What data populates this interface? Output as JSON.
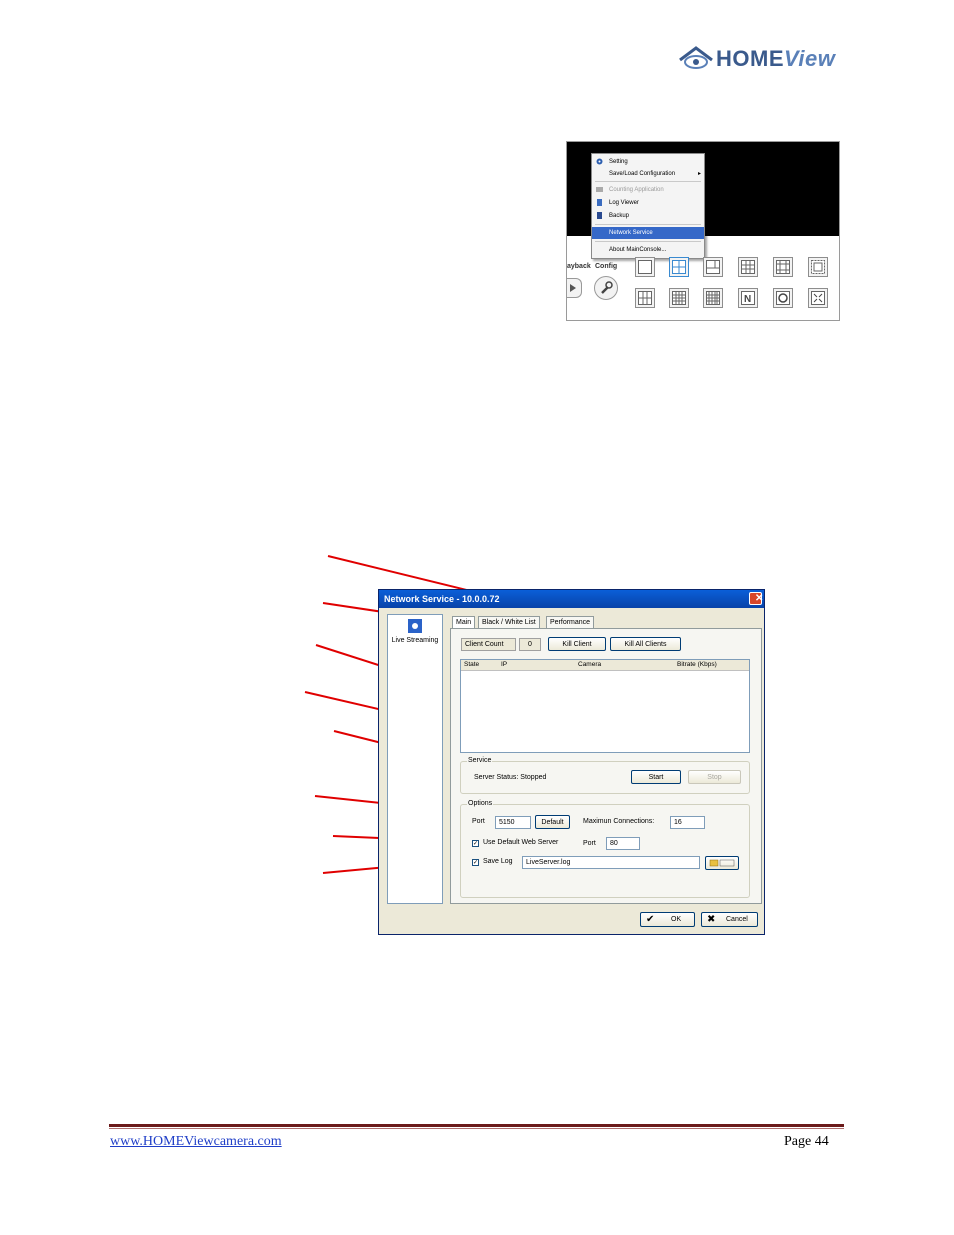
{
  "logo": {
    "brand_bold": "HOME",
    "brand_italic": "View"
  },
  "menu": {
    "items": [
      {
        "label": "Setting",
        "state": "normal"
      },
      {
        "label": "Save/Load Configuration",
        "state": "normal"
      },
      {
        "label": "Counting Application",
        "state": "disabled"
      },
      {
        "label": "Log Viewer",
        "state": "normal"
      },
      {
        "label": "Backup",
        "state": "normal"
      },
      {
        "label": "Network Service",
        "state": "highlighted"
      },
      {
        "label": "About MainConsole...",
        "state": "normal"
      }
    ],
    "playback_label": "ayback",
    "config_label": "Config"
  },
  "dialog": {
    "title": "Network Service - 10.0.0.72",
    "sidebar_item": "Live Streaming",
    "tabs": [
      "Main",
      "Black / White List",
      "Performance"
    ],
    "client_count_label": "Client Count",
    "client_count_value": "0",
    "kill_client": "Kill Client",
    "kill_all_clients": "Kill All Clients",
    "columns": [
      "State",
      "IP",
      "Camera",
      "Bitrate (Kbps)"
    ],
    "service_group": "Service",
    "server_status": "Server Status: Stopped",
    "start": "Start",
    "stop": "Stop",
    "options_group": "Options",
    "port_label": "Port",
    "port_value": "5150",
    "default_button": "Default",
    "max_conn_label": "Maximun Connections:",
    "max_conn_value": "16",
    "use_default_web": "Use Default Web Server",
    "web_port_label": "Port",
    "web_port_value": "80",
    "save_log": "Save Log",
    "log_file": "LiveServer.log",
    "ok": "OK",
    "cancel": "Cancel"
  },
  "footer": {
    "url": "www.HOMEViewcamera.com",
    "page": "Page 44"
  },
  "colors": {
    "accent": "#3a5a8c",
    "titlebar": "#0a5fd8",
    "callout": "#e00000",
    "rule": "#6b1a1a"
  }
}
